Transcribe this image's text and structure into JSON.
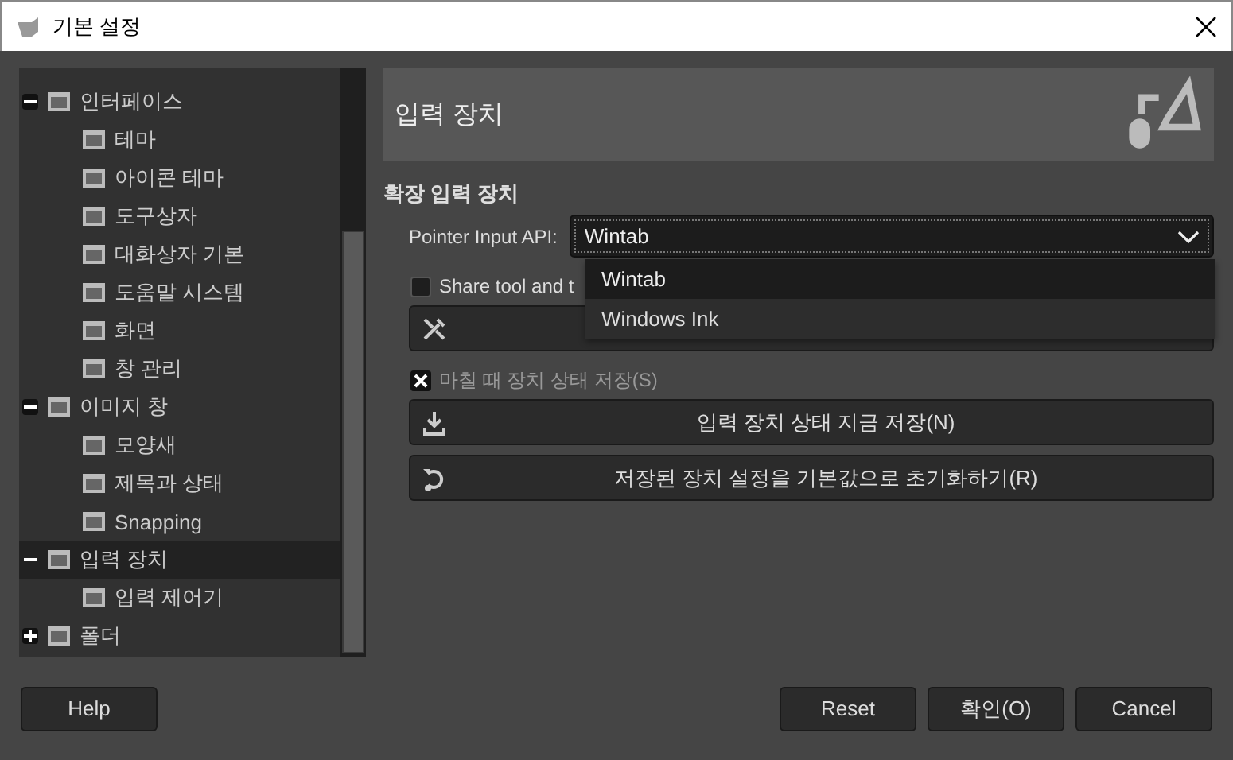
{
  "window": {
    "title": "기본 설정"
  },
  "tree": [
    {
      "label": "인터페이스",
      "expanded": true,
      "selected": false,
      "children": [
        {
          "label": "테마",
          "selected": false
        },
        {
          "label": "아이콘 테마",
          "selected": false
        },
        {
          "label": "도구상자",
          "selected": false
        },
        {
          "label": "대화상자 기본",
          "selected": false
        },
        {
          "label": "도움말 시스템",
          "selected": false
        },
        {
          "label": "화면",
          "selected": false
        },
        {
          "label": "창 관리",
          "selected": false
        }
      ]
    },
    {
      "label": "이미지 창",
      "expanded": true,
      "selected": false,
      "children": [
        {
          "label": "모양새",
          "selected": false
        },
        {
          "label": "제목과 상태",
          "selected": false
        },
        {
          "label": "Snapping",
          "selected": false
        }
      ]
    },
    {
      "label": "입력 장치",
      "expanded": true,
      "selected": true,
      "children": [
        {
          "label": "입력 제어기",
          "selected": false
        }
      ]
    },
    {
      "label": "폴더",
      "expanded": false,
      "selected": false
    }
  ],
  "page": {
    "title": "입력 장치",
    "section": "확장 입력 장치",
    "pointer_api": {
      "label": "Pointer Input API:",
      "value": "Wintab",
      "options": [
        {
          "label": "Wintab",
          "selected": true
        },
        {
          "label": "Windows Ink",
          "selected": false
        }
      ]
    },
    "share_checkbox": {
      "label": "Share tool and t",
      "checked": false
    },
    "save_on_exit": {
      "label": "마칠 때 장치 상태 저장(S)",
      "checked": true
    },
    "buttons": [
      {
        "kind": "hidden"
      },
      {
        "kind": "save",
        "label": "입력 장치 상태 지금 저장(N)"
      },
      {
        "kind": "reset",
        "label": "저장된 장치 설정을 기본값으로 초기화하기(R)"
      }
    ]
  },
  "footer": {
    "help": "Help",
    "buttons": [
      "Reset",
      "확인(O)",
      "Cancel"
    ]
  }
}
